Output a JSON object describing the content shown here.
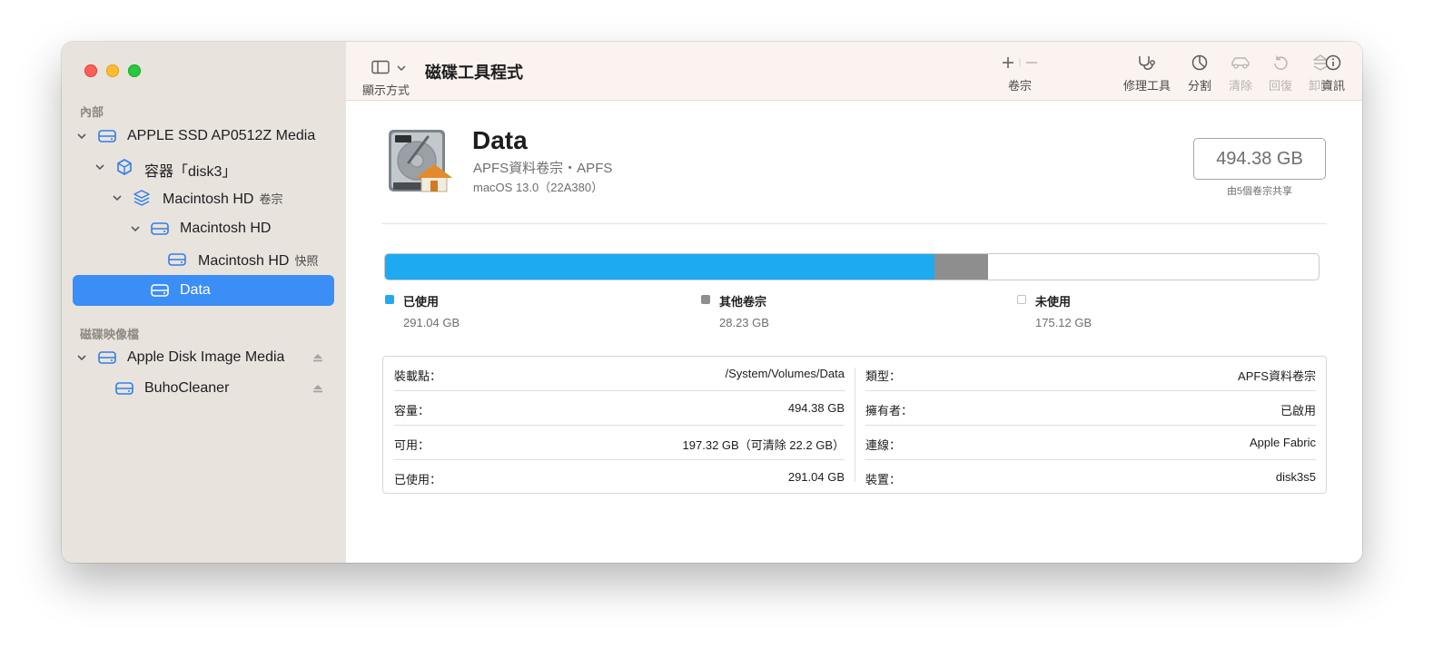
{
  "sidebar": {
    "section_internal": "內部",
    "section_images": "磁碟映像檔",
    "items": [
      {
        "label": "APPLE SSD AP0512Z Media",
        "suffix": ""
      },
      {
        "label": "容器「disk3」",
        "suffix": ""
      },
      {
        "label": "Macintosh HD",
        "suffix": "卷宗"
      },
      {
        "label": "Macintosh HD",
        "suffix": ""
      },
      {
        "label": "Macintosh HD",
        "suffix": "快照"
      },
      {
        "label": "Data",
        "suffix": ""
      },
      {
        "label": "Apple Disk Image Media",
        "suffix": ""
      },
      {
        "label": "BuhoCleaner",
        "suffix": ""
      }
    ]
  },
  "toolbar": {
    "view_label": "顯示方式",
    "title": "磁碟工具程式",
    "volume_label": "卷宗",
    "first_aid_label": "修理工具",
    "partition_label": "分割",
    "erase_label": "清除",
    "restore_label": "回復",
    "unmount_label": "卸除",
    "info_label": "資訊"
  },
  "volume": {
    "name": "Data",
    "type_line": "APFS資料卷宗・APFS",
    "os_line": "macOS 13.0（22A380）",
    "capacity": "494.38 GB",
    "capacity_note": "由5個卷宗共享"
  },
  "usage": {
    "total_gb": 494.38,
    "used": {
      "label": "已使用",
      "value": "291.04 GB",
      "gb": 291.04,
      "color": "#1eaaf1"
    },
    "other": {
      "label": "其他卷宗",
      "value": "28.23 GB",
      "gb": 28.23,
      "color": "#8e8e8e"
    },
    "free": {
      "label": "未使用",
      "value": "175.12 GB",
      "gb": 175.12,
      "color": "#ffffff"
    }
  },
  "info": {
    "left": [
      {
        "key": "裝載點：",
        "value": "/System/Volumes/Data"
      },
      {
        "key": "容量：",
        "value": "494.38 GB"
      },
      {
        "key": "可用：",
        "value": "197.32 GB（可清除 22.2 GB）"
      },
      {
        "key": "已使用：",
        "value": "291.04 GB"
      }
    ],
    "right": [
      {
        "key": "類型：",
        "value": "APFS資料卷宗"
      },
      {
        "key": "擁有者：",
        "value": "已啟用"
      },
      {
        "key": "連線：",
        "value": "Apple Fabric"
      },
      {
        "key": "裝置：",
        "value": "disk3s5"
      }
    ]
  },
  "icons": {
    "chevron": "chevron-down-icon",
    "drive": "drive-icon",
    "container": "container-cube-icon",
    "volume_group": "layers-icon",
    "eject": "eject-icon"
  }
}
